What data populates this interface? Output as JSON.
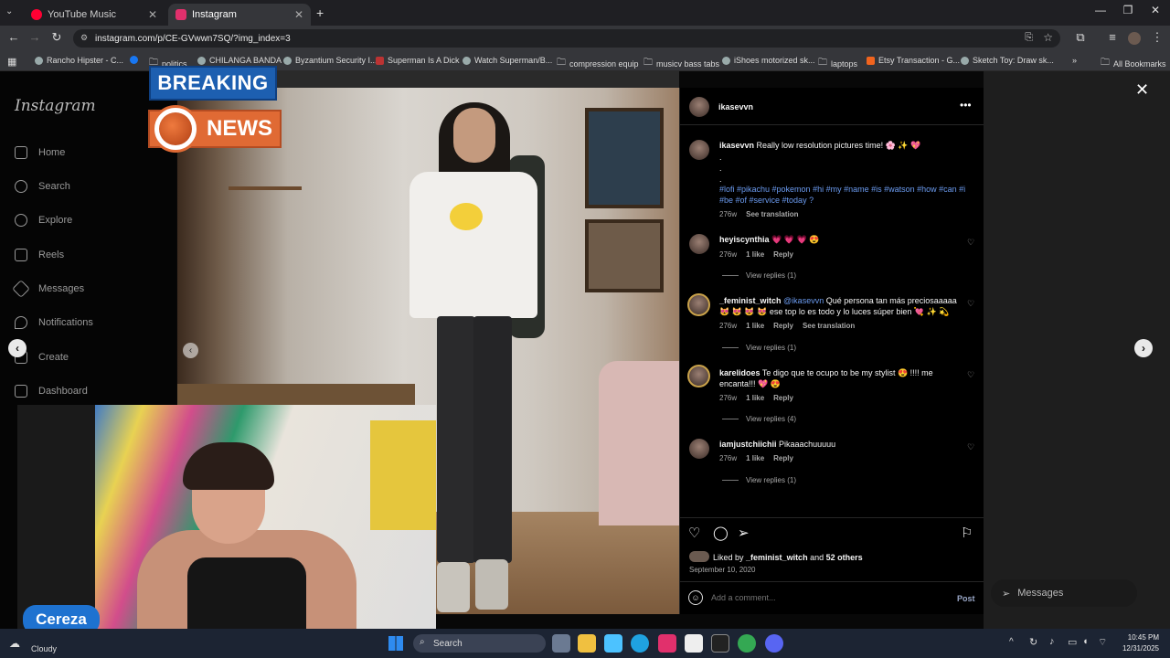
{
  "browser": {
    "tabs": [
      {
        "label": "YouTube Music",
        "active": false,
        "color": "#ff0033"
      },
      {
        "label": "Instagram",
        "active": true,
        "color": "#e1306c"
      }
    ],
    "new_tab": "+",
    "url": "instagram.com/p/CE-GVwwn7SQ/?img_index=3",
    "bookmarks": [
      "Rancho Hipster - C...",
      "politics",
      "CHILANGA BANDA",
      "Byzantium Security I...",
      "Superman Is A Dick",
      "Watch Superman/B...",
      "compression equip",
      "musicv bass tabs",
      "iShoes motorized sk...",
      "laptops",
      "Etsy Transaction - G...",
      "Sketch Toy: Draw sk...",
      "All Bookmarks"
    ]
  },
  "instagram": {
    "logo": "Instagram",
    "nav": [
      "Home",
      "Search",
      "Explore",
      "Reels",
      "Messages",
      "Notifications",
      "Create",
      "Dashboard"
    ],
    "post": {
      "author": "ikasevvn",
      "caption_text": "Really low resolution pictures time! 🌸 ✨ 💖",
      "caption_dots": [
        ".",
        ".",
        "."
      ],
      "hashtags": "#lofi #pikachu #pokemon #hi #my #name #is #watson #how #can #i #be #of #service #today ?",
      "caption_age": "276w",
      "see_translation": "See translation",
      "comments": [
        {
          "user": "heyiscynthia",
          "text": "💗 💗 💗 😍",
          "mention": "",
          "age": "276w",
          "likes": "1 like",
          "reply": "Reply",
          "translation": "",
          "view_replies": "View replies (1)"
        },
        {
          "user": "_feminist_witch",
          "mention": "@ikasevvn",
          "text": "Qué persona tan más preciosaaaaa 😻 😻 😻 😻 ese top lo es todo y lo luces súper bien 💘 ✨ 💫",
          "age": "276w",
          "likes": "1 like",
          "reply": "Reply",
          "translation": "See translation",
          "view_replies": "View replies (1)"
        },
        {
          "user": "karelidoes",
          "mention": "",
          "text": "Te digo que te ocupo to be my stylist 😍 !!!! me encanta!!! 💖 😍",
          "age": "276w",
          "likes": "1 like",
          "reply": "Reply",
          "translation": "",
          "view_replies": "View replies (4)"
        },
        {
          "user": "iamjustchiichii",
          "mention": "",
          "text": "Pikaaachuuuuu",
          "age": "276w",
          "likes": "1 like",
          "reply": "Reply",
          "translation": "",
          "view_replies": "View replies (1)"
        }
      ],
      "liked_by_prefix": "Liked by",
      "liked_by_user": "_feminist_witch",
      "liked_by_and": "and",
      "liked_by_others": "52 others",
      "date": "September 10, 2020",
      "comment_placeholder": "Add a comment...",
      "post_button": "Post"
    },
    "messages_pill": "Messages"
  },
  "overlay": {
    "breaking": "BREAKING",
    "news": "NEWS",
    "streamer_name": "Cereza"
  },
  "taskbar": {
    "weather": "Cloudy",
    "search_placeholder": "Search",
    "time": "10:45 PM",
    "date": "12/31/2025"
  }
}
